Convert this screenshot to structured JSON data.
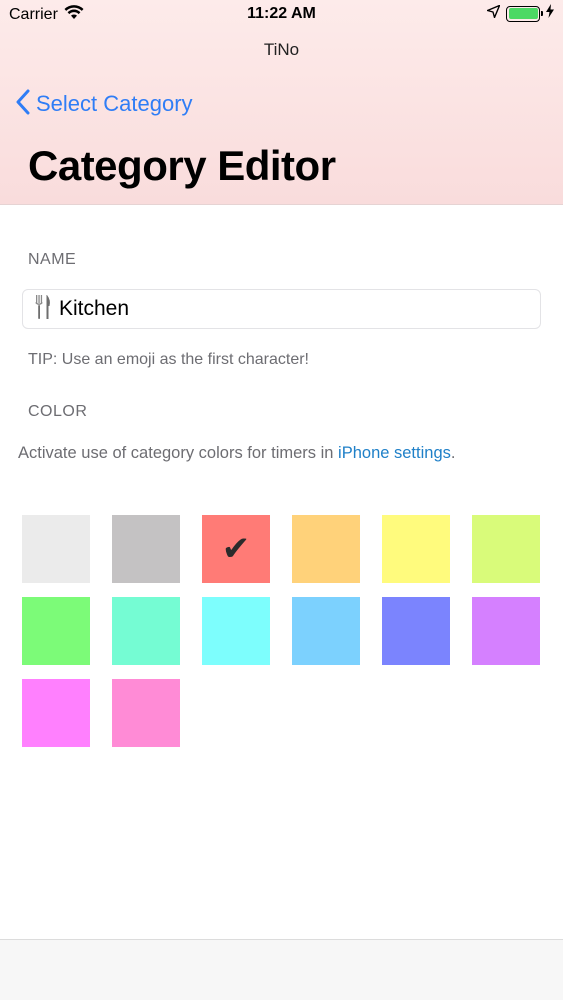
{
  "status_bar": {
    "carrier": "Carrier",
    "time": "11:22 AM"
  },
  "app": {
    "name": "TiNo"
  },
  "nav": {
    "back_label": "Select Category",
    "title": "Category Editor"
  },
  "name_section": {
    "label": "NAME",
    "value": "Kitchen",
    "emoji_icon": "fork-knife-icon",
    "tip": "TIP: Use an emoji as the first character!"
  },
  "color_section": {
    "label": "COLOR",
    "activate_text": "Activate use of category colors for timers in ",
    "activate_link": "iPhone settings",
    "activate_suffix": ".",
    "selected_index": 2,
    "check_glyph": "✔",
    "swatches": [
      "#ebebeb",
      "#c4c2c3",
      "#ff7b76",
      "#ffd27a",
      "#fffb7d",
      "#d9fb7a",
      "#7cfb78",
      "#75fcd3",
      "#7dfefd",
      "#7cd1fe",
      "#7b84fe",
      "#d580ff",
      "#ff80fe",
      "#ff8bd6"
    ]
  },
  "colors": {
    "accent": "#2f7df6",
    "link": "#1f80c8",
    "header_bg": "#fae0df"
  }
}
